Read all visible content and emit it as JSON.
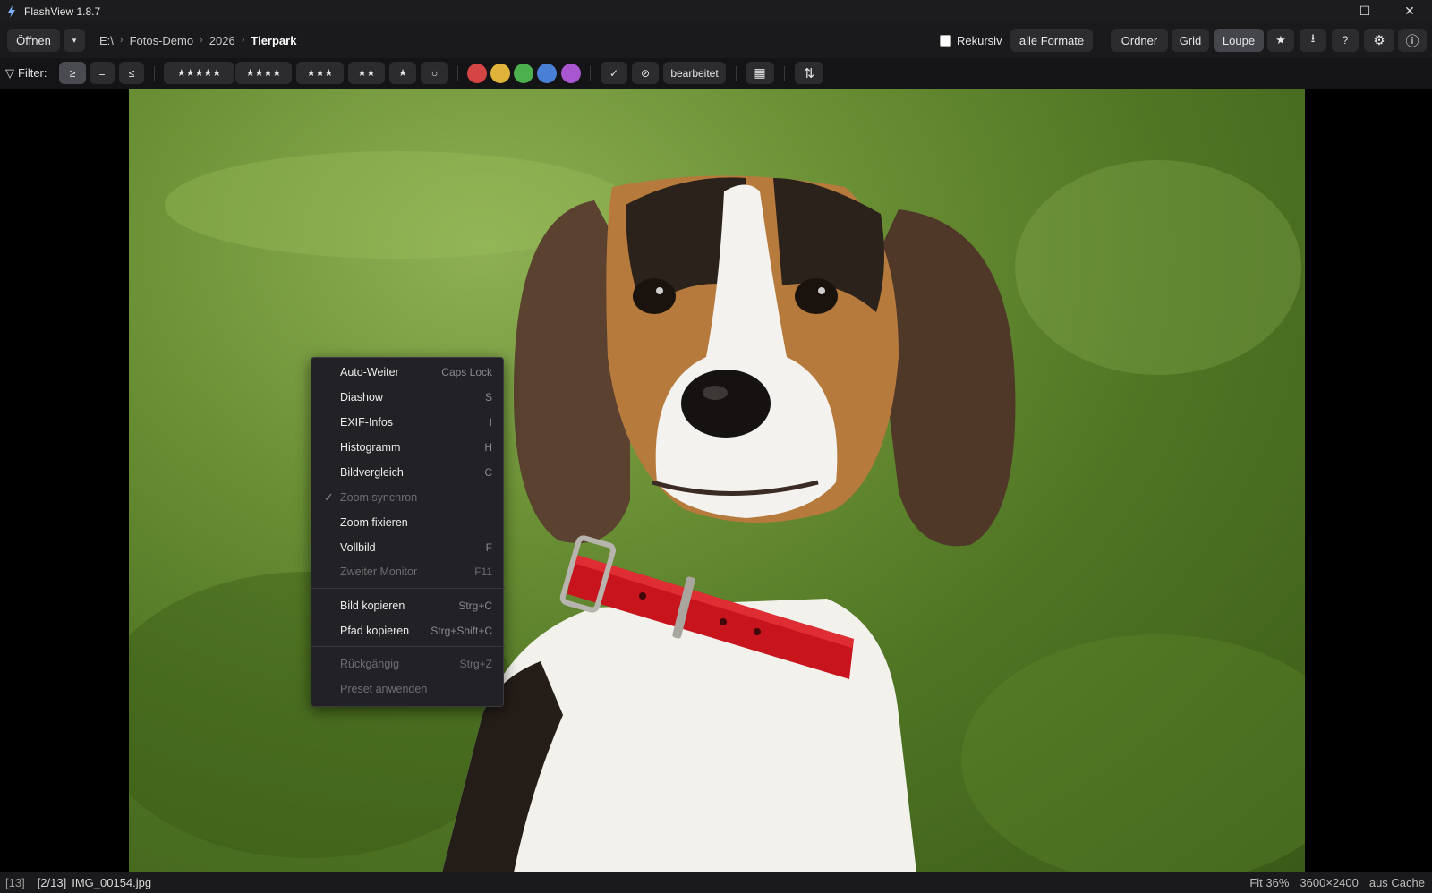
{
  "window": {
    "title": "FlashView 1.8.7",
    "controls": [
      "—",
      "☐",
      "✕"
    ]
  },
  "toolbar": {
    "open_label": "Öffnen",
    "open_dropdown": "▾",
    "breadcrumb": [
      "E:\\",
      "Fotos-Demo",
      "2026",
      "Tierpark"
    ],
    "breadcrumb_sep": "›",
    "recursive_label": "Rekursiv",
    "formats_label": "alle Formate",
    "view_ordner": "Ordner",
    "view_grid": "Grid",
    "view_loupe": "Loupe",
    "star_icon": "★",
    "download_icon": "⭳",
    "help_icon": "?",
    "settings_icon": "⚙",
    "info_icon": "ⓘ"
  },
  "filter": {
    "label": "Filter:",
    "funnel_icon": "▽",
    "cmp_ge": "≥",
    "cmp_eq": "=",
    "cmp_le": "≤",
    "stars5": "★★★★★",
    "stars4": "★★★★",
    "stars3": "★★★",
    "stars2": "★★",
    "stars1": "★",
    "stars0": "○",
    "colors": [
      "#d64545",
      "#e0b43a",
      "#4cb04c",
      "#4a7fd6",
      "#a857d0"
    ],
    "check_icon": "✓",
    "reject_icon": "⊘",
    "edited_label": "bearbeitet",
    "calendar_icon": "▦",
    "sort_icon": "⇅"
  },
  "context_menu": {
    "items": [
      {
        "label": "Auto-Weiter",
        "shortcut": "Caps Lock",
        "enabled": true,
        "checked": false
      },
      {
        "label": "Diashow",
        "shortcut": "S",
        "enabled": true,
        "checked": false
      },
      {
        "label": "EXIF-Infos",
        "shortcut": "I",
        "enabled": true,
        "checked": false
      },
      {
        "label": "Histogramm",
        "shortcut": "H",
        "enabled": true,
        "checked": false
      },
      {
        "label": "Bildvergleich",
        "shortcut": "C",
        "enabled": true,
        "checked": false
      },
      {
        "label": "Zoom synchron",
        "shortcut": "",
        "enabled": false,
        "checked": true
      },
      {
        "label": "Zoom fixieren",
        "shortcut": "",
        "enabled": true,
        "checked": false
      },
      {
        "label": "Vollbild",
        "shortcut": "F",
        "enabled": true,
        "checked": false
      },
      {
        "label": "Zweiter Monitor",
        "shortcut": "F11",
        "enabled": false,
        "checked": false
      },
      {
        "label": "Bild kopieren",
        "shortcut": "Strg+C",
        "enabled": true,
        "checked": false
      },
      {
        "label": "Pfad kopieren",
        "shortcut": "Strg+Shift+C",
        "enabled": true,
        "checked": false
      },
      {
        "label": "Rückgängig",
        "shortcut": "Strg+Z",
        "enabled": false,
        "checked": false
      },
      {
        "label": "Preset anwenden",
        "shortcut": "",
        "enabled": false,
        "checked": false
      }
    ]
  },
  "status": {
    "total": "[13]",
    "position": "[2/13]",
    "filename": "IMG_00154.jpg",
    "zoom": "Fit 36%",
    "dimensions": "3600×2400",
    "cache": "aus Cache"
  }
}
